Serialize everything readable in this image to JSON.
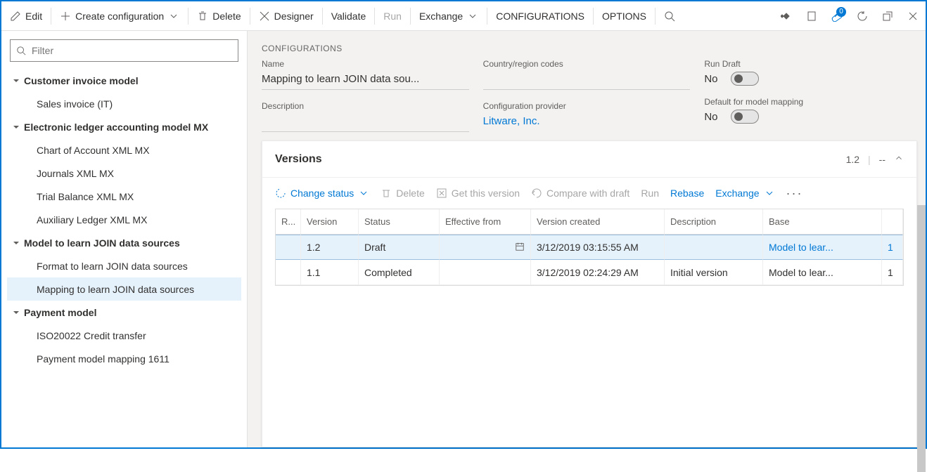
{
  "toolbar": {
    "edit": "Edit",
    "create": "Create configuration",
    "delete": "Delete",
    "designer": "Designer",
    "validate": "Validate",
    "run": "Run",
    "exchange": "Exchange",
    "configurations": "CONFIGURATIONS",
    "options": "OPTIONS",
    "badge_count": "0"
  },
  "filter": {
    "placeholder": "Filter"
  },
  "tree": {
    "n0": "Customer invoice model",
    "n0_0": "Sales invoice (IT)",
    "n1": "Electronic ledger accounting model MX",
    "n1_0": "Chart of Account XML MX",
    "n1_1": "Journals XML MX",
    "n1_2": "Trial Balance XML MX",
    "n1_3": "Auxiliary Ledger XML MX",
    "n2": "Model to learn JOIN data sources",
    "n2_0": "Format to learn JOIN data sources",
    "n2_1": "Mapping to learn JOIN data sources",
    "n3": "Payment model",
    "n3_0": "ISO20022 Credit transfer",
    "n3_1": "Payment model mapping 1611"
  },
  "details": {
    "section": "CONFIGURATIONS",
    "name_label": "Name",
    "name_value": "Mapping to learn JOIN data sou...",
    "desc_label": "Description",
    "desc_value": "",
    "country_label": "Country/region codes",
    "country_value": "",
    "provider_label": "Configuration provider",
    "provider_value": "Litware, Inc.",
    "run_draft_label": "Run Draft",
    "run_draft_value": "No",
    "default_label": "Default for model mapping",
    "default_value": "No"
  },
  "versions": {
    "title": "Versions",
    "header_ver": "1.2",
    "header_dash": "--",
    "tb": {
      "change_status": "Change status",
      "delete": "Delete",
      "get": "Get this version",
      "compare": "Compare with draft",
      "run": "Run",
      "rebase": "Rebase",
      "exchange": "Exchange"
    },
    "cols": {
      "r": "R...",
      "version": "Version",
      "status": "Status",
      "effective": "Effective from",
      "created": "Version created",
      "description": "Description",
      "base": "Base"
    },
    "rows": [
      {
        "version": "1.2",
        "status": "Draft",
        "effective": "",
        "created": "3/12/2019 03:15:55 AM",
        "description": "",
        "base": "Model to lear...",
        "num": "1"
      },
      {
        "version": "1.1",
        "status": "Completed",
        "effective": "",
        "created": "3/12/2019 02:24:29 AM",
        "description": "Initial version",
        "base": "Model to lear...",
        "num": "1"
      }
    ]
  }
}
